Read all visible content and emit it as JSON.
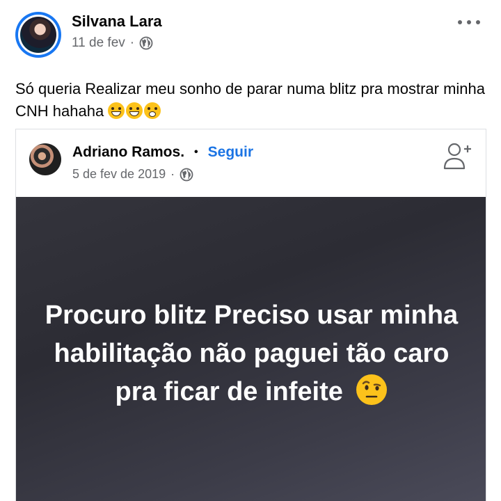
{
  "post": {
    "author": "Silvana Lara",
    "date": "11 de fev",
    "separator": "·",
    "text": "Só queria Realizar meu sonho de parar numa blitz pra mostrar minha CNH hahaha",
    "emojis": [
      "sweat-smile-emoji",
      "grin-emoji",
      "flushed-emoji"
    ],
    "privacy_icon": "globe-icon",
    "menu_icon": "more-options-icon"
  },
  "shared": {
    "author": "Adriano Ramos.",
    "bullet": "•",
    "follow_label": "Seguir",
    "date": "5 de fev de 2019",
    "separator": "·",
    "privacy_icon": "globe-icon",
    "action_icon": "add-friend-icon",
    "status_text": "Procuro blitz Preciso usar minha habilitação não paguei tão caro pra ficar de infeite",
    "status_emoji": "raised-eyebrow-emoji"
  },
  "colors": {
    "accent": "#1b74e4",
    "avatar_ring": "#1877f2",
    "secondary_text": "#65676b",
    "status_background": "#34343c"
  }
}
